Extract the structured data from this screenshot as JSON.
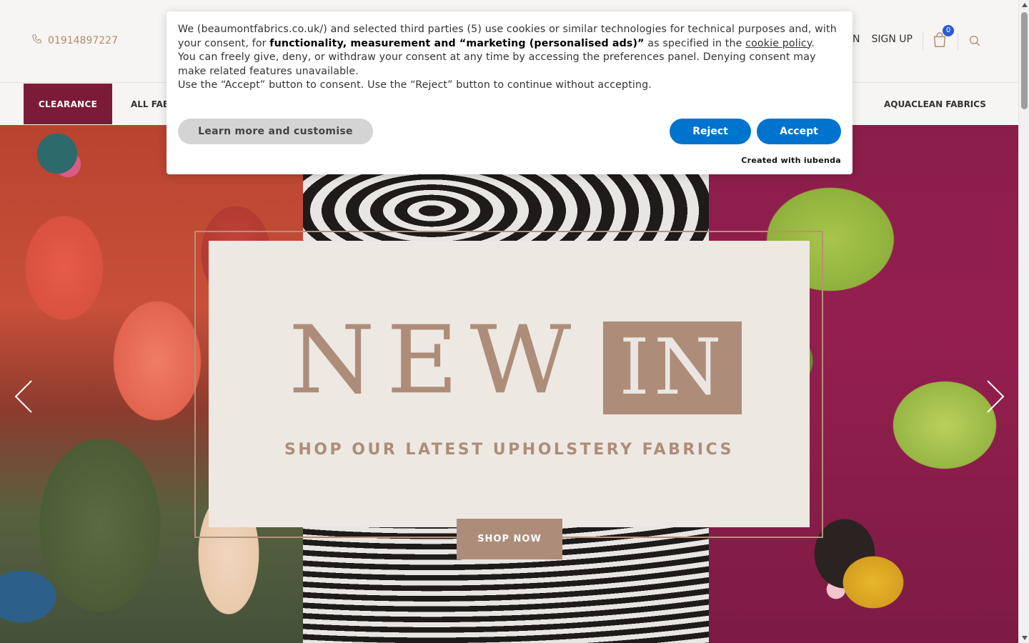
{
  "header": {
    "phone": "01914897227",
    "sign_in_partial": "IN",
    "sign_up": "SIGN UP",
    "cart_count": "0"
  },
  "nav": {
    "clearance": "CLEARANCE",
    "all_fabrics_partial": "ALL FABI",
    "aquaclean": "AQUACLEAN FABRICS"
  },
  "hero": {
    "headline_word1": "NEW",
    "headline_word2": "IN",
    "subheading": "SHOP OUR LATEST UPHOLSTERY FABRICS",
    "cta": "SHOP NOW"
  },
  "cookie": {
    "line1_prefix": "We (beaumontfabrics.co.uk/) and selected third parties (5) use cookies or similar technologies for technical purposes and, with your consent, for ",
    "line1_bold": "functionality, measurement and “marketing (personalised ads)”",
    "line1_mid": " as specified in the ",
    "line1_link": "cookie policy",
    "line1_end": ".",
    "line2": "You can freely give, deny, or withdraw your consent at any time by accessing the preferences panel. Denying consent may make related features unavailable.",
    "line3": "Use the “Accept” button to consent. Use the “Reject” button to continue without accepting.",
    "learn_more": "Learn more and customise",
    "reject": "Reject",
    "accept": "Accept",
    "credit": "Created with iubenda"
  },
  "colors": {
    "brand_maroon": "#7b1b37",
    "accent_tan": "#ad8d79",
    "cookie_button_blue": "#0073ce",
    "cart_badge_blue": "#2a5bd7"
  },
  "icons": [
    "phone-icon",
    "cart-icon",
    "search-icon",
    "chevron-left-icon",
    "chevron-right-icon"
  ]
}
